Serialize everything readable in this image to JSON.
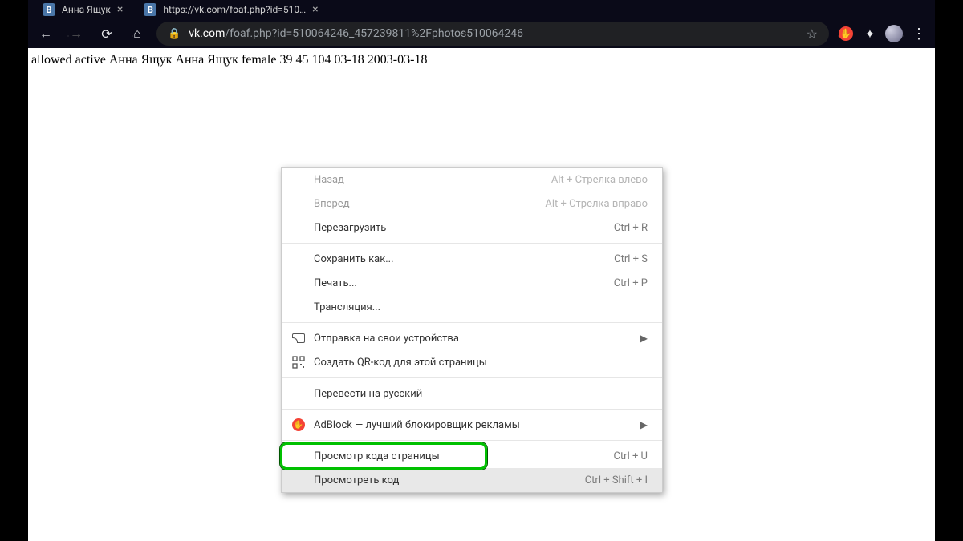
{
  "tabs": [
    {
      "favicon": "vk",
      "title": "Анна Ящук"
    },
    {
      "favicon": "vk",
      "title": "https://vk.com/foaf.php?id=510…"
    }
  ],
  "url": {
    "host": "vk.com",
    "path": "/foaf.php?id=510064246_457239811%2Fphotos510064246"
  },
  "page_text": "allowed active Анна Ящук Анна Ящук female 39 45 104 03-18 2003-03-18",
  "ctx": {
    "back": {
      "label": "Назад",
      "shortcut": "Alt + Стрелка влево"
    },
    "forward": {
      "label": "Вперед",
      "shortcut": "Alt + Стрелка вправо"
    },
    "reload": {
      "label": "Перезагрузить",
      "shortcut": "Ctrl + R"
    },
    "save_as": {
      "label": "Сохранить как...",
      "shortcut": "Ctrl + S"
    },
    "print": {
      "label": "Печать...",
      "shortcut": "Ctrl + P"
    },
    "cast": {
      "label": "Трансляция..."
    },
    "send_devices": {
      "label": "Отправка на свои устройства"
    },
    "create_qr": {
      "label": "Создать QR-код для этой страницы"
    },
    "translate": {
      "label": "Перевести на русский"
    },
    "adblock": {
      "label": "AdBlock — лучший блокировщик рекламы"
    },
    "view_source": {
      "label": "Просмотр кода страницы",
      "shortcut": "Ctrl + U"
    },
    "inspect": {
      "label": "Просмотреть код",
      "shortcut": "Ctrl + Shift + I"
    }
  }
}
